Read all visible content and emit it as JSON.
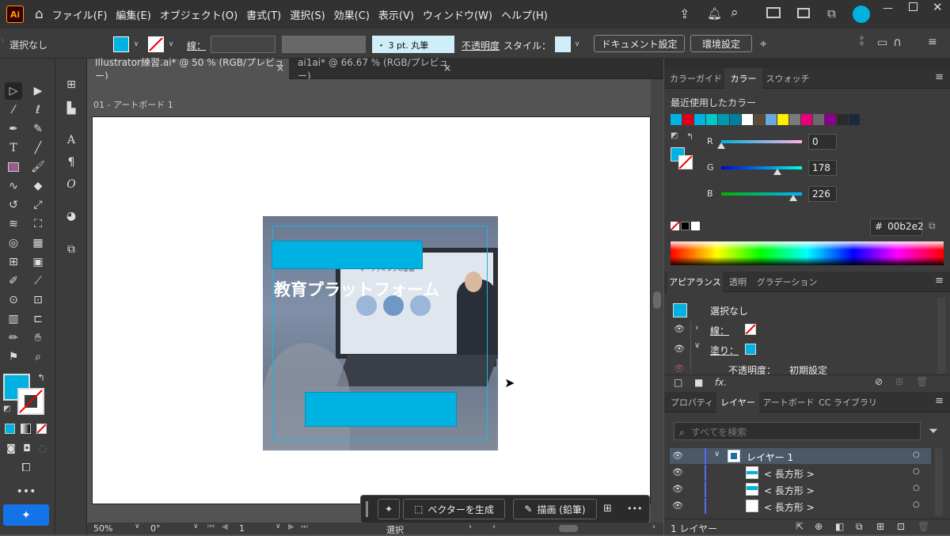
{
  "menubar": {
    "logo": "Ai",
    "items": [
      "ファイル(F)",
      "編集(E)",
      "オブジェクト(O)",
      "書式(T)",
      "選択(S)",
      "効果(C)",
      "表示(V)",
      "ウィンドウ(W)",
      "ヘルプ(H)"
    ]
  },
  "control": {
    "selection": "選択なし",
    "stroke_label": "線：",
    "brush": "・ 3 pt. 丸筆",
    "opacity": "不透明度",
    "style": "スタイル：",
    "doc_setup": "ドキュメント設定",
    "preferences": "環境設定"
  },
  "tabs": [
    {
      "label": "Illustrator練習.ai* @ 50 % (RGB/プレビュー)",
      "close": "×"
    },
    {
      "label": "ai1ai* @ 66.67 % (RGB/プレビュー)",
      "close": "×"
    }
  ],
  "artboard": {
    "name": "01 - アートボード 1",
    "headline": "教育プラットフォーム",
    "slide_title": "マーケティングの定義",
    "accent": "#00b2e2"
  },
  "statusbar": {
    "zoom": "50%",
    "angle": "0°",
    "page": "1",
    "tool": "選択"
  },
  "context_bar": {
    "generate": "ベクターを生成",
    "draw": "描画 (鉛筆)",
    "more": "•••"
  },
  "color_panel": {
    "tabs": [
      "カラーガイド",
      "カラー",
      "スウォッチ"
    ],
    "recent_label": "最近使用したカラー",
    "recent": [
      "#00b2e2",
      "#e0001a",
      "#00b2e2",
      "#00c8c8",
      "#009aaa",
      "#007ea0",
      "#ffffff",
      "#5a4a3a",
      "#6aa8e0",
      "#ffee00",
      "#7a7a7a",
      "#e4007f",
      "#6a6a6a",
      "#8a008a",
      "#2a2a2a",
      "#1a2a3a"
    ],
    "r_label": "R",
    "g_label": "G",
    "b_label": "B",
    "r": "0",
    "g": "178",
    "b": "226",
    "r_pct": 0,
    "g_pct": 70,
    "b_pct": 89,
    "hex_label": "#",
    "hex": "00b2e2"
  },
  "appearance_panel": {
    "tabs": [
      "アピアランス",
      "透明",
      "グラデーション"
    ],
    "selection": "選択なし",
    "stroke": "線：",
    "fill": "塗り：",
    "opacity": "不透明度：",
    "opacity_value": "初期設定",
    "fx": "fx."
  },
  "layers_panel": {
    "tabs": [
      "プロパティ",
      "レイヤー",
      "アートボード",
      "CC ライブラリ"
    ],
    "search_placeholder": "すべてを検索",
    "rows": [
      "レイヤー 1",
      "< 長方形 >",
      "< 長方形 >",
      "< 長方形 >"
    ],
    "footer": "1 レイヤー"
  }
}
